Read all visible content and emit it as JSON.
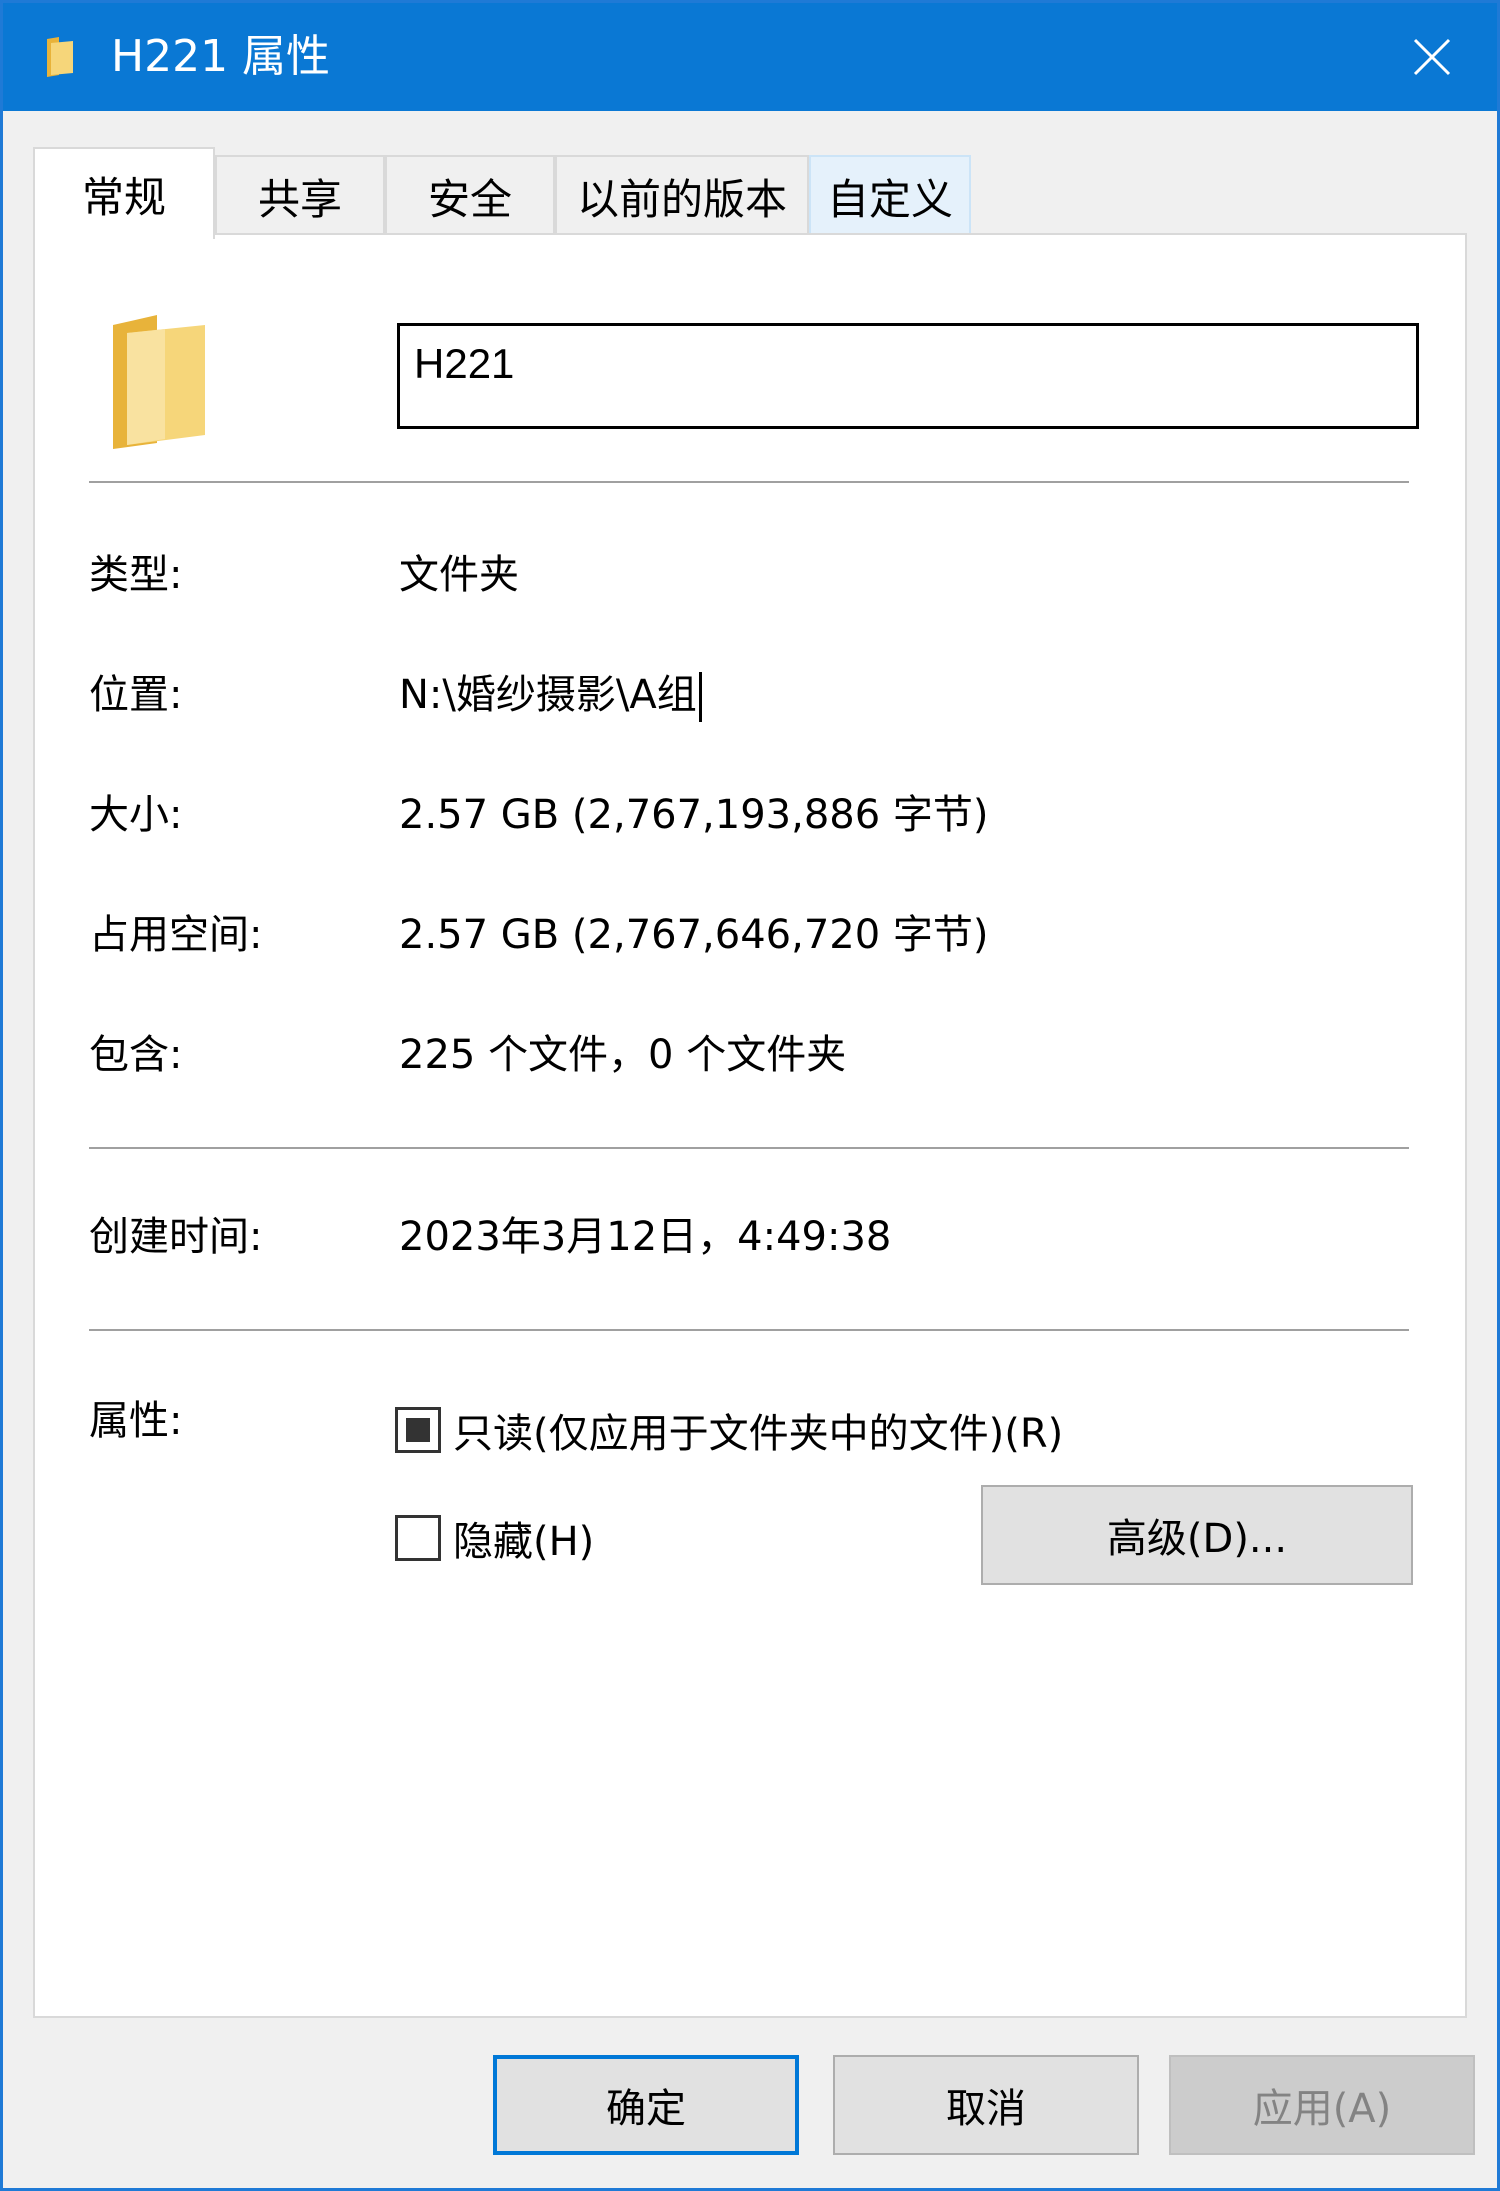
{
  "window": {
    "title": "H221 属性"
  },
  "tabs": [
    {
      "label": "常规",
      "active": true
    },
    {
      "label": "共享"
    },
    {
      "label": "安全"
    },
    {
      "label": "以前的版本"
    },
    {
      "label": "自定义",
      "hover": true
    }
  ],
  "general": {
    "name_value": "H221",
    "type_label": "类型:",
    "type_value": "文件夹",
    "location_label": "位置:",
    "location_value": "N:\\婚纱摄影\\A组",
    "size_label": "大小:",
    "size_value": "2.57 GB (2,767,193,886 字节)",
    "size_on_disk_label": "占用空间:",
    "size_on_disk_value": "2.57 GB (2,767,646,720 字节)",
    "contains_label": "包含:",
    "contains_value": "225 个文件，0 个文件夹",
    "created_label": "创建时间:",
    "created_value": "2023年3月12日，4:49:38",
    "attributes_label": "属性:",
    "readonly_label": "只读(仅应用于文件夹中的文件)(R)",
    "readonly_state": "indeterminate",
    "hidden_label": "隐藏(H)",
    "hidden_checked": false,
    "advanced_button": "高级(D)..."
  },
  "footer": {
    "ok_label": "确定",
    "cancel_label": "取消",
    "apply_label": "应用(A)"
  },
  "colors": {
    "titlebar": "#0a78d4",
    "folder": "#f6d67a",
    "default_button_border": "#0078d7"
  }
}
